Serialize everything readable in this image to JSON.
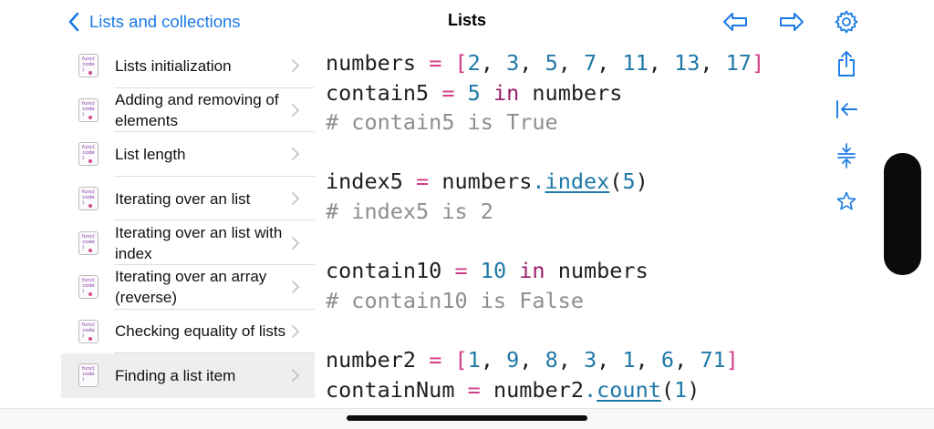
{
  "colors": {
    "accent": "#1a7ae6",
    "keyword": "#9a1f6b",
    "number": "#1f78a8",
    "operator": "#d23d8a",
    "comment": "#8e8e8e"
  },
  "header": {
    "back_label": "Lists and collections",
    "title": "Lists",
    "icons": [
      "chevron-left-icon",
      "arrow-left-icon",
      "arrow-right-icon",
      "gear-icon"
    ]
  },
  "sidebar": {
    "thumb": [
      "func(",
      "code",
      ")"
    ],
    "items": [
      {
        "label": "Lists initialization"
      },
      {
        "label": "Adding and removing of elements"
      },
      {
        "label": "List length"
      },
      {
        "label": "Iterating over an list"
      },
      {
        "label": "Iterating over an list with index"
      },
      {
        "label": "Iterating over an array (reverse)"
      },
      {
        "label": "Checking equality of lists"
      },
      {
        "label": "Finding a list item",
        "selected": true
      }
    ]
  },
  "code": {
    "lines": [
      "numbers = [2, 3, 5, 7, 11, 13, 17]",
      "contain5 = 5 in numbers",
      "# contain5 is True",
      "",
      "index5 = numbers.index(5)",
      "# index5 is 2",
      "",
      "contain10 = 10 in numbers",
      "# contain10 is False",
      "",
      "number2 = [1, 9, 8, 3, 1, 6, 71]",
      "containNum = number2.count(1)"
    ]
  },
  "toolbar": {
    "icons": [
      "share-icon",
      "collapse-left-icon",
      "fold-lines-icon",
      "star-icon"
    ]
  }
}
